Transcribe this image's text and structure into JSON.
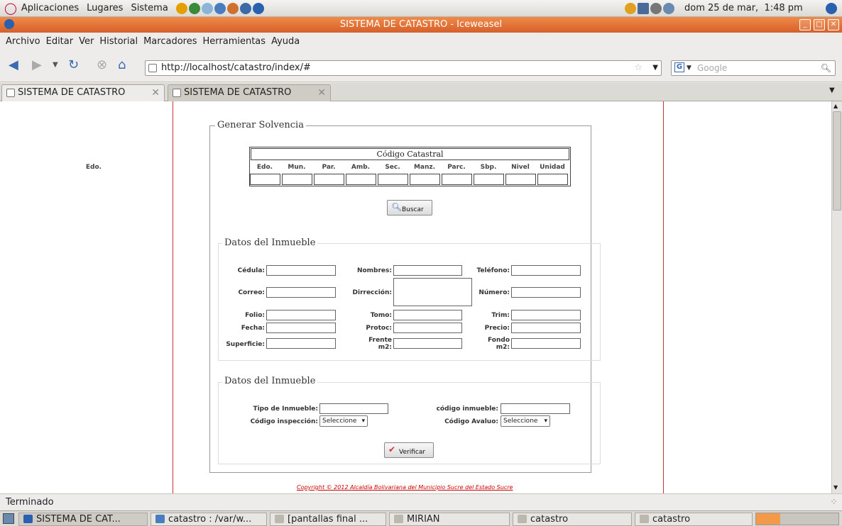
{
  "panel": {
    "menus": [
      "Aplicaciones",
      "Lugares",
      "Sistema"
    ],
    "clock": "dom 25 de mar,  1:48 pm"
  },
  "window": {
    "title": "SISTEMA DE CATASTRO - Iceweasel"
  },
  "menubar": [
    "Archivo",
    "Editar",
    "Ver",
    "Historial",
    "Marcadores",
    "Herramientas",
    "Ayuda"
  ],
  "nav": {
    "url": "http://localhost/catastro/index/#",
    "search_placeholder": "Google"
  },
  "tabs": [
    "SISTEMA DE CATASTRO",
    "SISTEMA DE CATASTRO"
  ],
  "form": {
    "legend": "Generar Solvencia",
    "codigo_title": "Código Catastral",
    "codigo_cols": [
      "Edo.",
      "Mun.",
      "Par.",
      "Amb.",
      "Sec.",
      "Manz.",
      "Parc.",
      "Sbp.",
      "Nivel",
      "Unidad"
    ],
    "buscar": "Buscar",
    "section1": {
      "legend": "Datos del Inmueble",
      "col1": [
        "Cédula:",
        "Correo:",
        "Folio:",
        "Fecha:",
        "Superficie:"
      ],
      "col2": [
        "Nombres:",
        "Dirrección:",
        "Tomo:",
        "Protoc:",
        "Frente m2:"
      ],
      "col3": [
        "Teléfono:",
        "Número:",
        "Trim:",
        "Precio:",
        "Fondo m2:"
      ]
    },
    "section2": {
      "legend": "Datos del Inmueble",
      "tipo": "Tipo de Inmueble:",
      "codigo_inmueble": "código inmueble:",
      "codigo_inspeccion": "Código inspección:",
      "codigo_avaluo": "Código Avaluo:",
      "select_value": "Seleccione"
    },
    "verificar": "Verificar",
    "copyright": "Copyright © 2012 Alcaldía Bolivariana del Municipio Sucre del Estado Sucre"
  },
  "status": "Terminado",
  "taskbar": [
    "SISTEMA DE CAT...",
    "catastro : /var/w...",
    "[pantallas final ...",
    "MIRIAN",
    "catastro",
    "catastro"
  ]
}
